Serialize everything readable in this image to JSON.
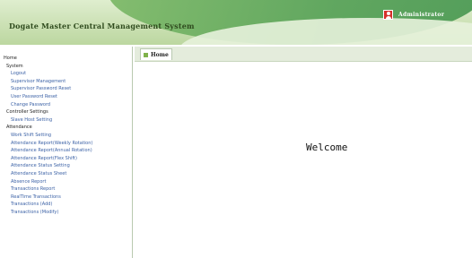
{
  "header": {
    "title": "Dogate Master Central Management System",
    "user_name": "Administrator"
  },
  "sidebar": {
    "items": [
      {
        "label": "Home",
        "level": 0
      },
      {
        "label": "System",
        "level": 1
      },
      {
        "label": "Logout",
        "level": 2
      },
      {
        "label": "Supervisor Management",
        "level": 2
      },
      {
        "label": "Supervisor Password Reset",
        "level": 2
      },
      {
        "label": "User Password Reset",
        "level": 2
      },
      {
        "label": "Change Password",
        "level": 2
      },
      {
        "label": "Controller Settings",
        "level": 1
      },
      {
        "label": "Slave Host Setting",
        "level": 2
      },
      {
        "label": "Attendance",
        "level": 1
      },
      {
        "label": "Work Shift Setting",
        "level": 2
      },
      {
        "label": "Attendance Report(Weekly Rotation)",
        "level": 2
      },
      {
        "label": "Attendance Report(Annual Rotation)",
        "level": 2
      },
      {
        "label": "Attendance Report(Flex Shift)",
        "level": 2
      },
      {
        "label": "Attendance Status Setting",
        "level": 2
      },
      {
        "label": "Attendance Status Sheet",
        "level": 2
      },
      {
        "label": "Absence Report",
        "level": 2
      },
      {
        "label": "Transactions Report",
        "level": 2
      },
      {
        "label": "RealTime Transactions",
        "level": 2
      },
      {
        "label": "Transactions (Add)",
        "level": 2
      },
      {
        "label": "Transactions (Modify)",
        "level": 2
      }
    ]
  },
  "tabs": [
    {
      "label": "Home"
    }
  ],
  "main": {
    "welcome_text": "Welcome"
  }
}
